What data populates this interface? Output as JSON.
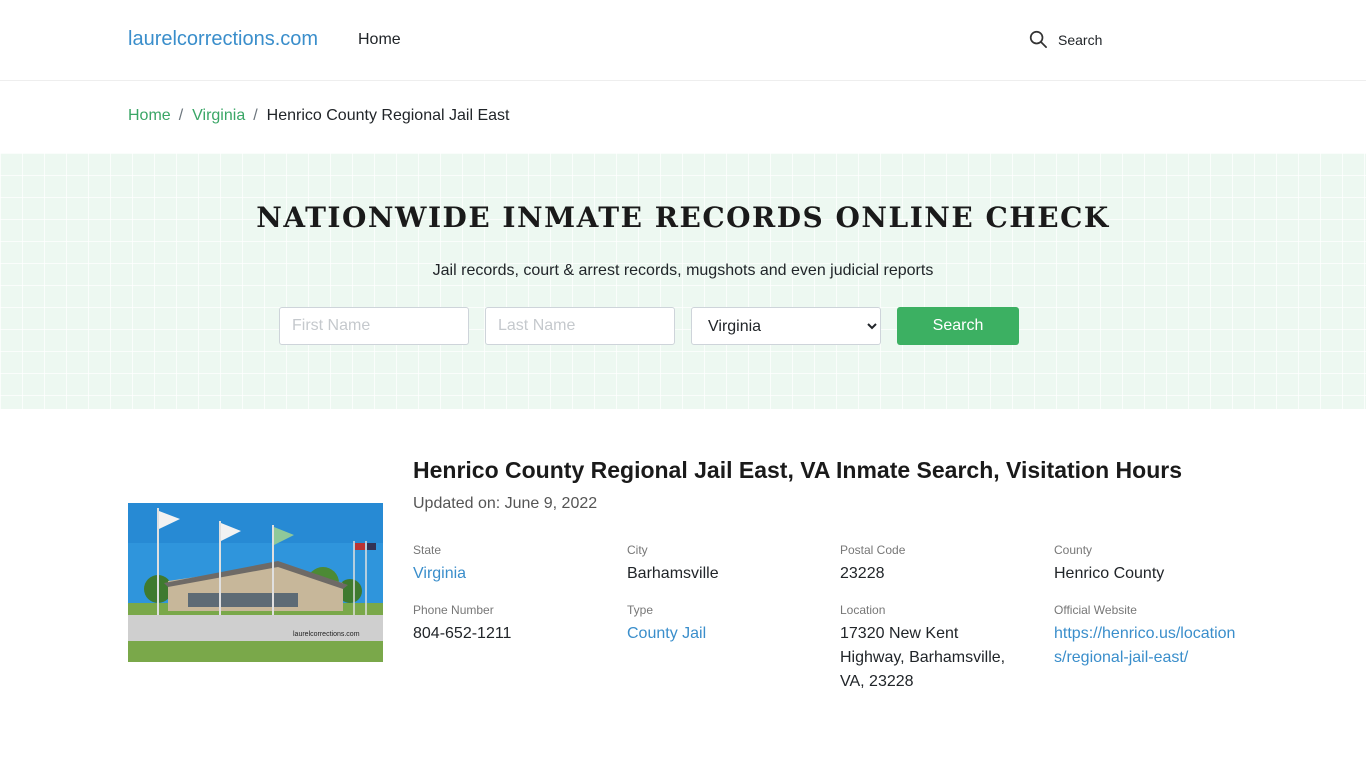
{
  "header": {
    "brand": "laurelcorrections.com",
    "nav_home": "Home",
    "search_label": "Search"
  },
  "breadcrumb": {
    "items": [
      "Home",
      "Virginia"
    ],
    "current": "Henrico County Regional Jail East",
    "separator": "/"
  },
  "hero": {
    "title": "NATIONWIDE INMATE RECORDS ONLINE CHECK",
    "subtitle": "Jail records, court & arrest records, mugshots and even judicial reports",
    "first_name_placeholder": "First Name",
    "last_name_placeholder": "Last Name",
    "state_selected": "Virginia",
    "search_button": "Search"
  },
  "facility": {
    "title": "Henrico County Regional Jail East, VA Inmate Search, Visitation Hours",
    "updated": "Updated on: June 9, 2022",
    "image_watermark": "laurelcorrections.com",
    "fields": {
      "state": {
        "label": "State",
        "value": "Virginia"
      },
      "city": {
        "label": "City",
        "value": "Barhamsville"
      },
      "postal_code": {
        "label": "Postal Code",
        "value": "23228"
      },
      "county": {
        "label": "County",
        "value": "Henrico County"
      },
      "phone": {
        "label": "Phone Number",
        "value": "804-652-1211"
      },
      "type": {
        "label": "Type",
        "value": "County Jail"
      },
      "location": {
        "label": "Location",
        "value": "17320 New Kent Highway, Barhamsville, VA, 23228"
      },
      "website": {
        "label": "Official Website",
        "value": "https://henrico.us/locations/regional-jail-east/"
      }
    }
  },
  "colors": {
    "brand_blue": "#3a8ecb",
    "breadcrumb_green": "#3aa666",
    "button_green": "#3cb062",
    "hero_bg": "#edf8f1"
  }
}
